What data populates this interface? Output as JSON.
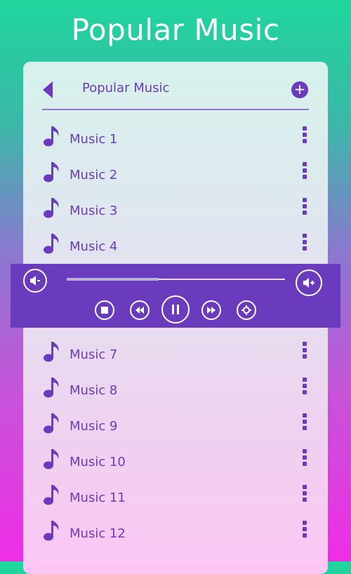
{
  "app": {
    "title": "Popular Music"
  },
  "header": {
    "title": "Popular Music",
    "back_icon": "triangle-left-icon",
    "add_icon": "plus-circle-icon"
  },
  "list_top": {
    "items": [
      {
        "label": "Music 1"
      },
      {
        "label": "Music 2"
      },
      {
        "label": "Music 3"
      },
      {
        "label": "Music 4"
      }
    ]
  },
  "player": {
    "progress_fraction": 0.42,
    "controls": [
      "volume-down-icon",
      "stop-icon",
      "rewind-icon",
      "pause-icon",
      "fast-forward-icon",
      "settings-icon",
      "volume-up-icon"
    ]
  },
  "list_bottom": {
    "items": [
      {
        "label": "Music 7"
      },
      {
        "label": "Music 8"
      },
      {
        "label": "Music 9"
      },
      {
        "label": "Music 10"
      },
      {
        "label": "Music 11"
      },
      {
        "label": "Music 12"
      }
    ]
  },
  "colors": {
    "accent": "#6a3bbd",
    "player_bg": "#6a3bbd",
    "text": "#6a3bbd"
  }
}
